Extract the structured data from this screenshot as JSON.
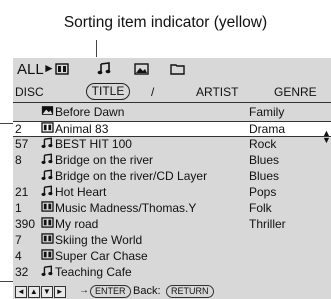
{
  "callout": {
    "text": "Sorting item indicator (yellow)"
  },
  "header": {
    "all": "ALL",
    "arrow": "►",
    "icons": [
      "video-icon",
      "music-icon",
      "photo-icon",
      "folder-icon"
    ]
  },
  "columns": {
    "disc": "DISC",
    "title": "TITLE",
    "slash": "/",
    "artist": "ARTIST",
    "genre": "GENRE"
  },
  "rows": [
    {
      "num": "",
      "icon": "photo-icon",
      "title": "Before Dawn",
      "genre": "Family"
    },
    {
      "num": "2",
      "icon": "video-icon",
      "title": "Animal 83",
      "genre": "Drama"
    },
    {
      "num": "57",
      "icon": "music-icon",
      "title": "BEST HIT 100",
      "genre": "Rock"
    },
    {
      "num": "8",
      "icon": "music-icon",
      "title": "Bridge on the river",
      "genre": "Blues"
    },
    {
      "num": "",
      "icon": "music-icon",
      "title": "Bridge on the river/CD Layer",
      "genre": "Blues"
    },
    {
      "num": "21",
      "icon": "music-icon",
      "title": "Hot Heart",
      "genre": "Pops"
    },
    {
      "num": "1",
      "icon": "video-icon",
      "title": "Music Madness/Thomas.Y",
      "genre": "Folk"
    },
    {
      "num": "390",
      "icon": "video-icon",
      "title": "My road",
      "genre": "Thriller"
    },
    {
      "num": "7",
      "icon": "video-icon",
      "title": "Skiing the World",
      "genre": ""
    },
    {
      "num": "4",
      "icon": "video-icon",
      "title": "Super Car Chase",
      "genre": ""
    },
    {
      "num": "32",
      "icon": "music-icon",
      "title": "Teaching Cafe",
      "genre": ""
    }
  ],
  "footer": {
    "enter_label": "ENTER",
    "back_label": "Back:",
    "return_label": "RETURN"
  }
}
